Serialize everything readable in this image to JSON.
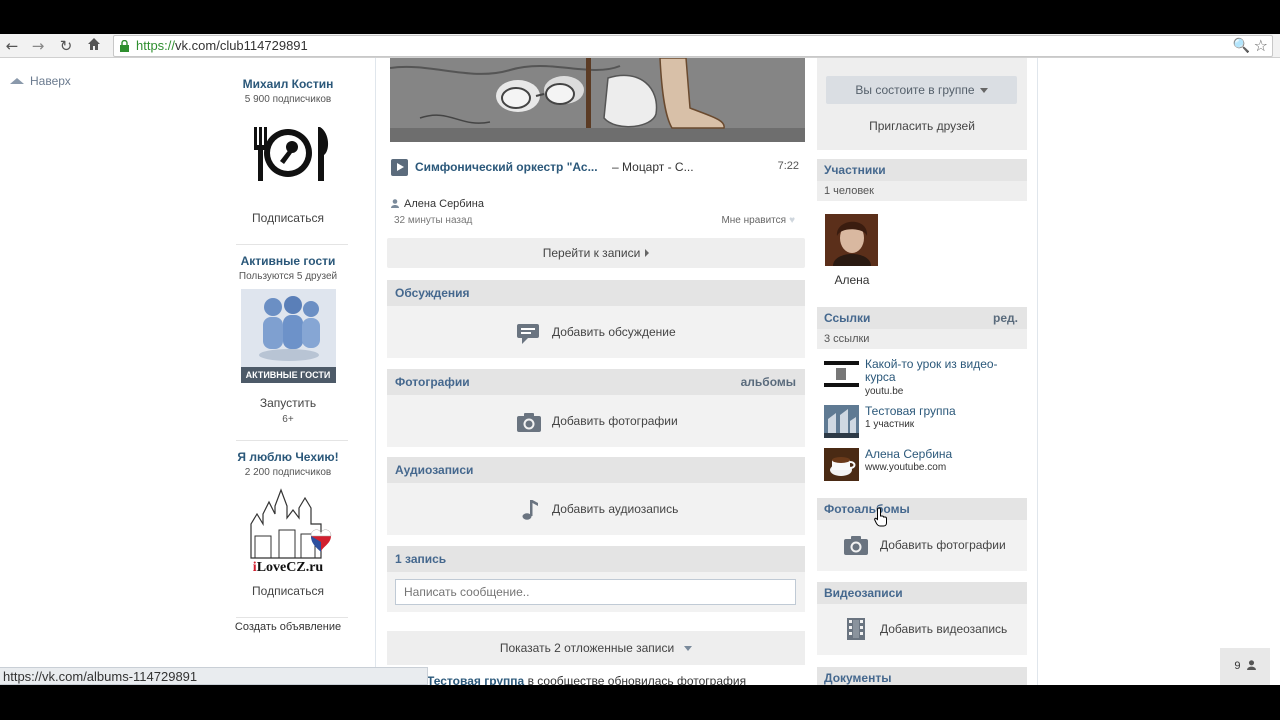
{
  "browser": {
    "url_proto": "https://",
    "url_rest": "vk.com/club114729891"
  },
  "nav": {
    "to_top": "Наверх"
  },
  "ads": [
    {
      "title": "Михаил Костин",
      "sub": "5 900 подписчиков",
      "action": "Подписаться"
    },
    {
      "title": "Активные гости",
      "sub": "Пользуются 5 друзей",
      "image_caption": "АКТИВНЫЕ ГОСТИ",
      "action": "Запустить",
      "age": "6+"
    },
    {
      "title": "Я люблю Чехию!",
      "sub": "2 200 подписчиков",
      "image_caption": "iLoveCZ.ru",
      "action": "Подписаться"
    }
  ],
  "create_ad": "Создать объявление",
  "post": {
    "audio_artist": "Симфонический оркестр \"Ас...",
    "audio_song": "– Моцарт - С...",
    "audio_duration": "7:22",
    "author": "Алена Сербина",
    "time": "32 минуты назад",
    "like": "Мне нравится",
    "goto": "Перейти к записи"
  },
  "blocks": {
    "discussions": {
      "title": "Обсуждения",
      "action": "Добавить обсуждение"
    },
    "photos": {
      "title": "Фотографии",
      "right": "альбомы",
      "action": "Добавить фотографии"
    },
    "audio": {
      "title": "Аудиозаписи",
      "action": "Добавить аудиозапись"
    }
  },
  "wall": {
    "count": "1 запись",
    "placeholder": "Написать сообщение..",
    "deferred": "Показать 2 отложенные записи",
    "notify_group": "Тестовая группа",
    "notify_text": "в сообществе обновилась фотография"
  },
  "sidebar": {
    "member_button": "Вы состоите в группе",
    "invite": "Пригласить друзей",
    "members_title": "Участники",
    "members_count": "1 человек",
    "member_name": "Алена",
    "links_title": "Ссылки",
    "links_edit": "ред.",
    "links_count": "3 ссылки",
    "links": [
      {
        "title": "Какой-то урок из видео-",
        "title2": "курса",
        "sub": "youtu.be"
      },
      {
        "title": "Тестовая группа",
        "sub": "1 участник"
      },
      {
        "title": "Алена Сербина",
        "sub": "www.youtube.com"
      }
    ],
    "albums_title": "Фотоальбомы",
    "albums_action": "Добавить фотографии",
    "videos_title": "Видеозаписи",
    "videos_action": "Добавить видеозапись",
    "docs_title": "Документы"
  },
  "status_url": "https://vk.com/albums-114729891",
  "counter": "9"
}
